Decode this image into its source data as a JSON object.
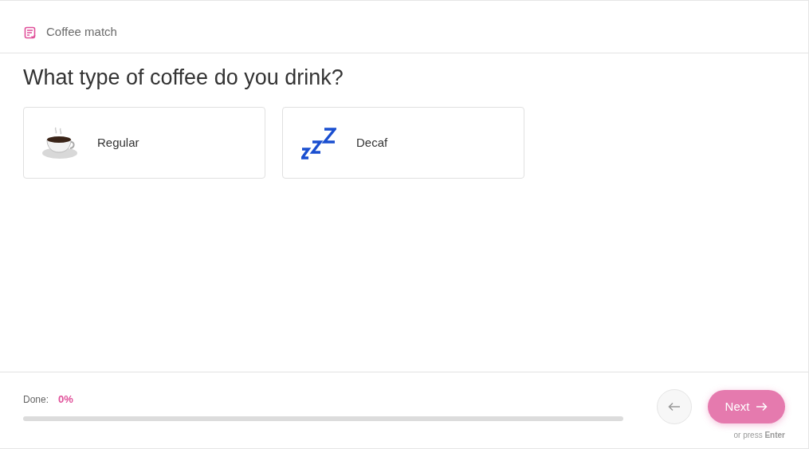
{
  "header": {
    "title": "Coffee match"
  },
  "question": "What type of coffee do you drink?",
  "options": [
    {
      "label": "Regular",
      "kind": "cup",
      "selected": false
    },
    {
      "label": "Decaf",
      "kind": "sleep",
      "selected": false
    }
  ],
  "progress": {
    "label": "Done:",
    "value": "0%",
    "level": 0
  },
  "navigation": {
    "next": "Next",
    "hint": "or press **Enter**"
  }
}
